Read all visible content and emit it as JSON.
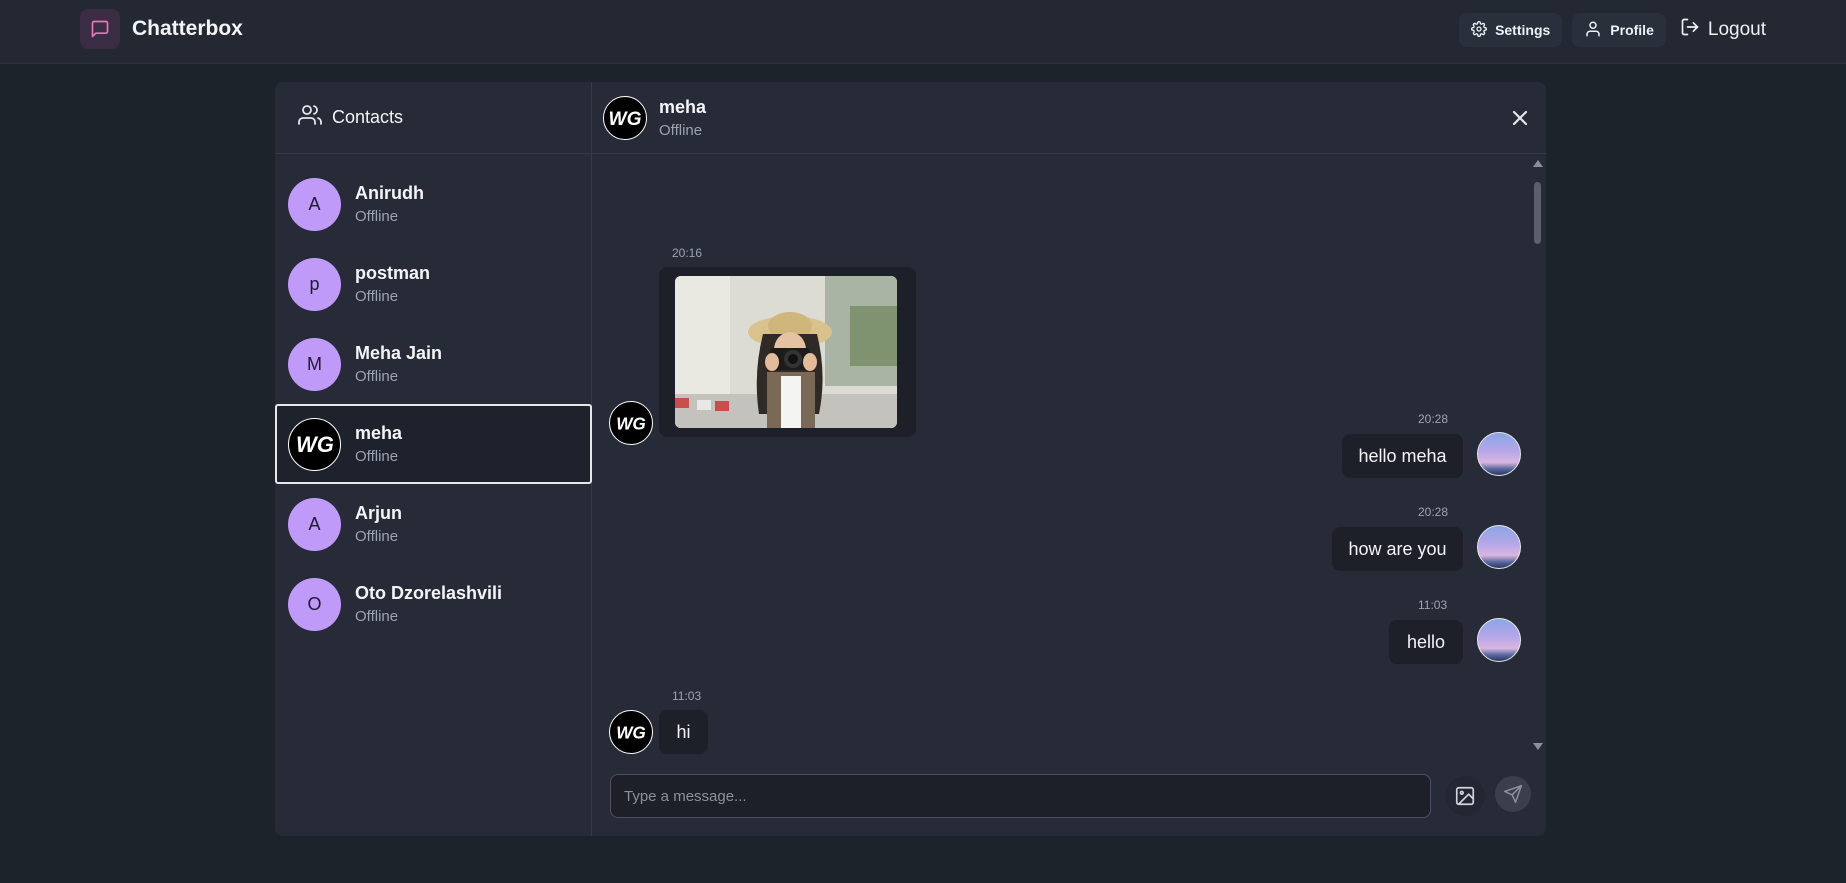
{
  "app": {
    "title": "Chatterbox"
  },
  "nav": {
    "settings": "Settings",
    "profile": "Profile",
    "logout": "Logout"
  },
  "sidebar": {
    "title": "Contacts",
    "contacts": [
      {
        "initial": "A",
        "name": "Anirudh",
        "status": "Offline"
      },
      {
        "initial": "p",
        "name": "postman",
        "status": "Offline"
      },
      {
        "initial": "M",
        "name": "Meha Jain",
        "status": "Offline"
      },
      {
        "initial": "WG",
        "name": "meha",
        "status": "Offline"
      },
      {
        "initial": "A",
        "name": "Arjun",
        "status": "Offline"
      },
      {
        "initial": "O",
        "name": "Oto Dzorelashvili",
        "status": "Offline"
      }
    ]
  },
  "chat": {
    "name": "meha",
    "status": "Offline",
    "messages": [
      {
        "time": "20:16",
        "type": "image"
      },
      {
        "time": "20:28",
        "text": "hello meha"
      },
      {
        "time": "20:28",
        "text": "how are you"
      },
      {
        "time": "11:03",
        "text": "hello"
      },
      {
        "time": "11:03",
        "text": "hi"
      }
    ],
    "input_placeholder": "Type a message..."
  },
  "colors": {
    "avatar": "#c09af8",
    "brand_icon": "#e879b9",
    "background": "#1d232a"
  }
}
